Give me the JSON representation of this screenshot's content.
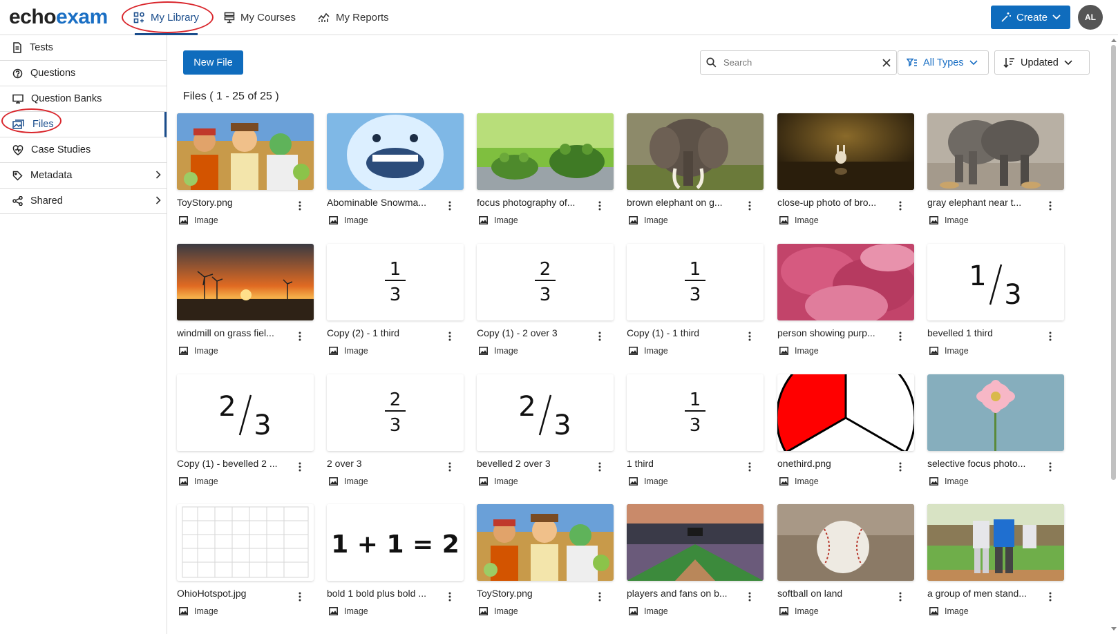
{
  "header": {
    "logo_part1": "echo",
    "logo_part2": "exam",
    "tabs": [
      {
        "label": "My Library",
        "icon": "library-icon",
        "active": true
      },
      {
        "label": "My Courses",
        "icon": "courses-icon",
        "active": false
      },
      {
        "label": "My Reports",
        "icon": "reports-icon",
        "active": false
      }
    ],
    "create_label": "Create",
    "avatar_initials": "AL"
  },
  "sidebar": {
    "items": [
      {
        "label": "Tests",
        "icon": "test-document-icon"
      },
      {
        "label": "Questions",
        "icon": "question-icon"
      },
      {
        "label": "Question Banks",
        "icon": "question-bank-icon"
      },
      {
        "label": "Files",
        "icon": "files-icon",
        "active": true
      },
      {
        "label": "Case Studies",
        "icon": "case-studies-icon"
      },
      {
        "label": "Metadata",
        "icon": "tag-icon",
        "expandable": true
      },
      {
        "label": "Shared",
        "icon": "share-icon",
        "expandable": true
      }
    ]
  },
  "toolbar": {
    "new_file_label": "New File",
    "search_placeholder": "Search",
    "type_filter": "All Types",
    "sort": "Updated"
  },
  "files_heading": "Files ( 1 - 25 of 25 )",
  "type_label": "Image",
  "accent_color": "#0f6cbd",
  "files": [
    {
      "name": "ToyStory.png",
      "thumb": "toy-story"
    },
    {
      "name": "Abominable Snowma...",
      "thumb": "snowman"
    },
    {
      "name": "focus photography of...",
      "thumb": "frogs"
    },
    {
      "name": "brown elephant on g...",
      "thumb": "elephant-brown"
    },
    {
      "name": "close-up photo of bro...",
      "thumb": "bunny"
    },
    {
      "name": "gray elephant near t...",
      "thumb": "elephant-gray"
    },
    {
      "name": "windmill on grass fiel...",
      "thumb": "windmill"
    },
    {
      "name": "Copy (2) - 1 third",
      "thumb": "stacked-fraction",
      "numerator": "1",
      "denominator": "3"
    },
    {
      "name": "Copy (1) - 2 over 3",
      "thumb": "stacked-fraction",
      "numerator": "2",
      "denominator": "3"
    },
    {
      "name": "Copy (1) - 1 third",
      "thumb": "stacked-fraction",
      "numerator": "1",
      "denominator": "3"
    },
    {
      "name": "person showing purp...",
      "thumb": "flower-pink"
    },
    {
      "name": "bevelled 1 third",
      "thumb": "bevelled-fraction",
      "numerator": "1",
      "denominator": "3"
    },
    {
      "name": "Copy (1) - bevelled 2 ...",
      "thumb": "bevelled-fraction",
      "numerator": "2",
      "denominator": "3"
    },
    {
      "name": "2 over 3",
      "thumb": "stacked-fraction",
      "numerator": "2",
      "denominator": "3"
    },
    {
      "name": "bevelled 2 over 3",
      "thumb": "bevelled-fraction",
      "numerator": "2",
      "denominator": "3"
    },
    {
      "name": "1 third",
      "thumb": "stacked-fraction",
      "numerator": "1",
      "denominator": "3"
    },
    {
      "name": "onethird.png",
      "thumb": "pie-third"
    },
    {
      "name": "selective focus photo...",
      "thumb": "gerbera"
    },
    {
      "name": "OhioHotspot.jpg",
      "thumb": "ohio-map"
    },
    {
      "name": "bold 1 bold plus bold ...",
      "thumb": "equation",
      "equation": "1 + 1 = 2"
    },
    {
      "name": "ToyStory.png",
      "thumb": "toy-story"
    },
    {
      "name": "players and fans on b...",
      "thumb": "stadium"
    },
    {
      "name": "softball on land",
      "thumb": "baseball"
    },
    {
      "name": "a group of men stand...",
      "thumb": "players"
    }
  ]
}
